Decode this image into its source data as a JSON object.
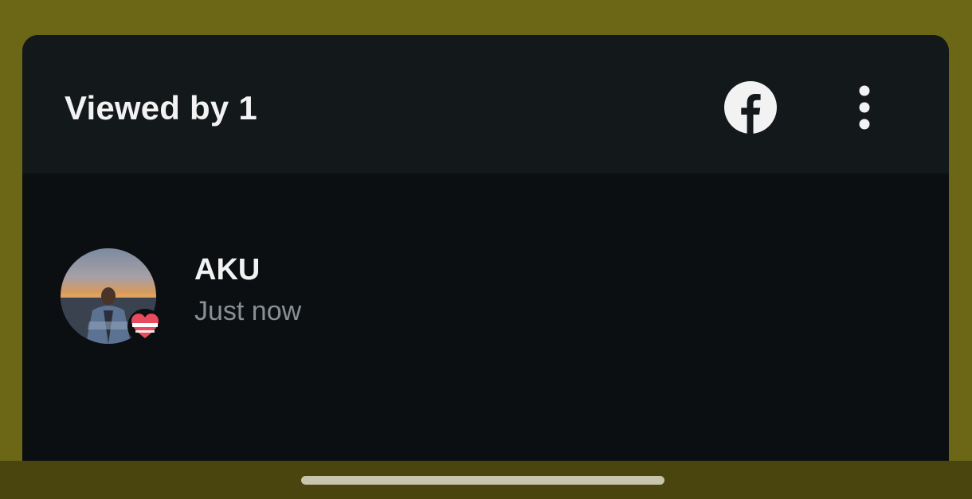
{
  "header": {
    "title": "Viewed by 1",
    "facebook_icon": "facebook-icon",
    "more_icon": "more-vertical-icon"
  },
  "viewers": [
    {
      "name": "AKU",
      "time": "Just now",
      "reaction_icon": "heart-icon"
    }
  ],
  "colors": {
    "background": "#6b6717",
    "sheet": "#0b0f12",
    "header": "#13181b",
    "text_primary": "#f2f2f2",
    "text_secondary": "#8a8f94",
    "reaction": "#e84b5e"
  }
}
